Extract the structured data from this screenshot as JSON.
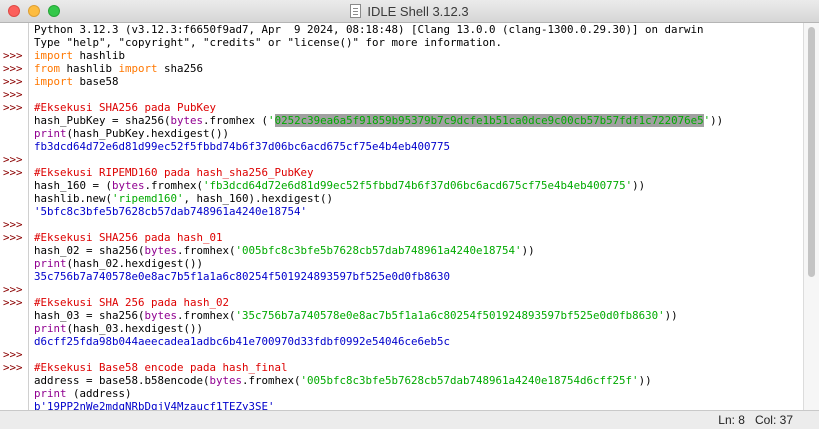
{
  "window": {
    "title": "IDLE Shell 3.12.3"
  },
  "gutter": {
    "prompt": ">>>"
  },
  "shell": {
    "lines": [
      {
        "p": false,
        "segs": [
          {
            "c": "",
            "t": "Python 3.12.3 (v3.12.3:f6650f9ad7, Apr  9 2024, 08:18:48) [Clang 13.0.0 (clang-1300.0.29.30)] on darwin"
          }
        ]
      },
      {
        "p": false,
        "segs": [
          {
            "c": "",
            "t": "Type \"help\", \"copyright\", \"credits\" or \"license()\" for more information."
          }
        ]
      },
      {
        "p": true,
        "segs": [
          {
            "c": "kw",
            "t": "import"
          },
          {
            "c": "",
            "t": " hashlib"
          }
        ]
      },
      {
        "p": true,
        "segs": [
          {
            "c": "kw",
            "t": "from"
          },
          {
            "c": "",
            "t": " hashlib "
          },
          {
            "c": "kw",
            "t": "import"
          },
          {
            "c": "",
            "t": " sha256"
          }
        ]
      },
      {
        "p": true,
        "segs": [
          {
            "c": "kw",
            "t": "import"
          },
          {
            "c": "",
            "t": " base58"
          }
        ]
      },
      {
        "p": true,
        "segs": [
          {
            "c": "",
            "t": ""
          }
        ]
      },
      {
        "p": true,
        "segs": [
          {
            "c": "cm",
            "t": "#Eksekusi SHA256 pada PubKey"
          }
        ]
      },
      {
        "p": false,
        "segs": [
          {
            "c": "",
            "t": "hash_PubKey = sha256("
          },
          {
            "c": "bi",
            "t": "bytes"
          },
          {
            "c": "",
            "t": ".fromhex ("
          },
          {
            "c": "str",
            "t": "'"
          },
          {
            "c": "sel",
            "t": "0252c39ea6a5f91859b95379b7c9dcfe1b51ca0dce9c00cb57b57fdf1c722076e5"
          },
          {
            "c": "str",
            "t": "'"
          },
          {
            "c": "",
            "t": "))"
          }
        ]
      },
      {
        "p": false,
        "segs": [
          {
            "c": "bi",
            "t": "print"
          },
          {
            "c": "",
            "t": "(hash_PubKey.hexdigest())"
          }
        ]
      },
      {
        "p": false,
        "segs": [
          {
            "c": "out",
            "t": "fb3dcd64d72e6d81d99ec52f5fbbd74b6f37d06bc6acd675cf75e4b4eb400775"
          }
        ]
      },
      {
        "p": true,
        "segs": [
          {
            "c": "",
            "t": ""
          }
        ]
      },
      {
        "p": true,
        "segs": [
          {
            "c": "cm",
            "t": "#Eksekusi RIPEMD160 pada hash_sha256_PubKey"
          }
        ]
      },
      {
        "p": false,
        "segs": [
          {
            "c": "",
            "t": "hash_160 = ("
          },
          {
            "c": "bi",
            "t": "bytes"
          },
          {
            "c": "",
            "t": ".fromhex("
          },
          {
            "c": "str",
            "t": "'fb3dcd64d72e6d81d99ec52f5fbbd74b6f37d06bc6acd675cf75e4b4eb400775'"
          },
          {
            "c": "",
            "t": "))"
          }
        ]
      },
      {
        "p": false,
        "segs": [
          {
            "c": "",
            "t": "hashlib.new("
          },
          {
            "c": "str",
            "t": "'ripemd160'"
          },
          {
            "c": "",
            "t": ", hash_160).hexdigest()"
          }
        ]
      },
      {
        "p": false,
        "segs": [
          {
            "c": "out",
            "t": "'5bfc8c3bfe5b7628cb57dab748961a4240e18754'"
          }
        ]
      },
      {
        "p": true,
        "segs": [
          {
            "c": "",
            "t": ""
          }
        ]
      },
      {
        "p": true,
        "segs": [
          {
            "c": "cm",
            "t": "#Eksekusi SHA256 pada hash_01"
          }
        ]
      },
      {
        "p": false,
        "segs": [
          {
            "c": "",
            "t": "hash_02 = sha256("
          },
          {
            "c": "bi",
            "t": "bytes"
          },
          {
            "c": "",
            "t": ".fromhex("
          },
          {
            "c": "str",
            "t": "'005bfc8c3bfe5b7628cb57dab748961a4240e18754'"
          },
          {
            "c": "",
            "t": "))"
          }
        ]
      },
      {
        "p": false,
        "segs": [
          {
            "c": "bi",
            "t": "print"
          },
          {
            "c": "",
            "t": "(hash_02.hexdigest())"
          }
        ]
      },
      {
        "p": false,
        "segs": [
          {
            "c": "out",
            "t": "35c756b7a740578e0e8ac7b5f1a1a6c80254f501924893597bf525e0d0fb8630"
          }
        ]
      },
      {
        "p": true,
        "segs": [
          {
            "c": "",
            "t": ""
          }
        ]
      },
      {
        "p": true,
        "segs": [
          {
            "c": "cm",
            "t": "#Eksekusi SHA 256 pada hash_02"
          }
        ]
      },
      {
        "p": false,
        "segs": [
          {
            "c": "",
            "t": "hash_03 = sha256("
          },
          {
            "c": "bi",
            "t": "bytes"
          },
          {
            "c": "",
            "t": ".fromhex("
          },
          {
            "c": "str",
            "t": "'35c756b7a740578e0e8ac7b5f1a1a6c80254f501924893597bf525e0d0fb8630'"
          },
          {
            "c": "",
            "t": "))"
          }
        ]
      },
      {
        "p": false,
        "segs": [
          {
            "c": "bi",
            "t": "print"
          },
          {
            "c": "",
            "t": "(hash_03.hexdigest())"
          }
        ]
      },
      {
        "p": false,
        "segs": [
          {
            "c": "out",
            "t": "d6cff25fda98b044aeecadea1adbc6b41e700970d33fdbf0992e54046ce6eb5c"
          }
        ]
      },
      {
        "p": true,
        "segs": [
          {
            "c": "",
            "t": ""
          }
        ]
      },
      {
        "p": true,
        "segs": [
          {
            "c": "cm",
            "t": "#Eksekusi Base58 encode pada hash_final"
          }
        ]
      },
      {
        "p": false,
        "segs": [
          {
            "c": "",
            "t": "address = base58.b58encode("
          },
          {
            "c": "bi",
            "t": "bytes"
          },
          {
            "c": "",
            "t": ".fromhex("
          },
          {
            "c": "str",
            "t": "'005bfc8c3bfe5b7628cb57dab748961a4240e18754d6cff25f'"
          },
          {
            "c": "",
            "t": "))"
          }
        ]
      },
      {
        "p": false,
        "segs": [
          {
            "c": "bi",
            "t": "print"
          },
          {
            "c": "",
            "t": " (address)"
          }
        ]
      },
      {
        "p": false,
        "segs": [
          {
            "c": "out",
            "t": "b'19PP2nWe2mdqNRbDqjV4Mzaucf1TEZy3SE'"
          }
        ]
      }
    ]
  },
  "status": {
    "line": "Ln: 8",
    "col": "Col: 37"
  }
}
